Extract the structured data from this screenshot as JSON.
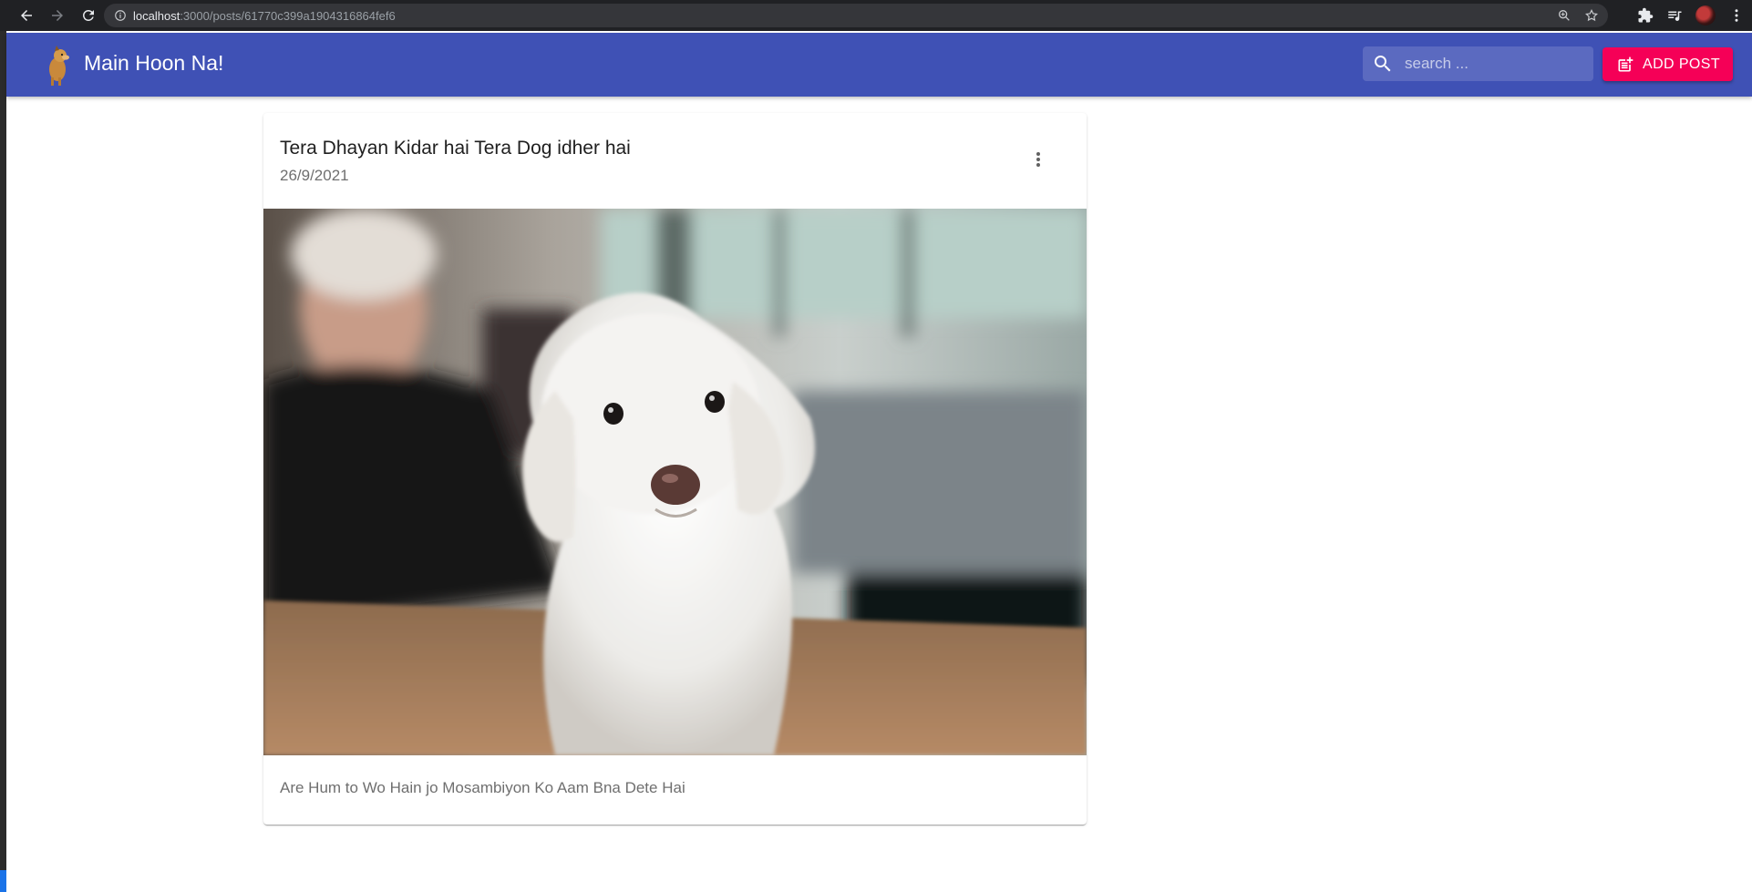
{
  "browser": {
    "url_host": "localhost",
    "url_rest": ":3000/posts/61770c399a1904316864fef6"
  },
  "app": {
    "brand": "Main Hoon Na!",
    "search_placeholder": "search ...",
    "add_post_label": "ADD POST",
    "colors": {
      "appbar": "#3f51b5",
      "accent": "#f50057"
    }
  },
  "post": {
    "title": "Tera Dhayan Kidar hai Tera Dog idher hai",
    "date": "26/9/2021",
    "message": "Are Hum to Wo Hain jo Mosambiyon Ko Aam Bna Dete Hai"
  },
  "icons": [
    "back-icon",
    "forward-icon",
    "reload-icon",
    "info-icon",
    "zoom-icon",
    "star-icon",
    "extensions-icon",
    "reading-list-icon",
    "menu-icon",
    "search-icon",
    "add-post-icon",
    "more-vert-icon"
  ]
}
